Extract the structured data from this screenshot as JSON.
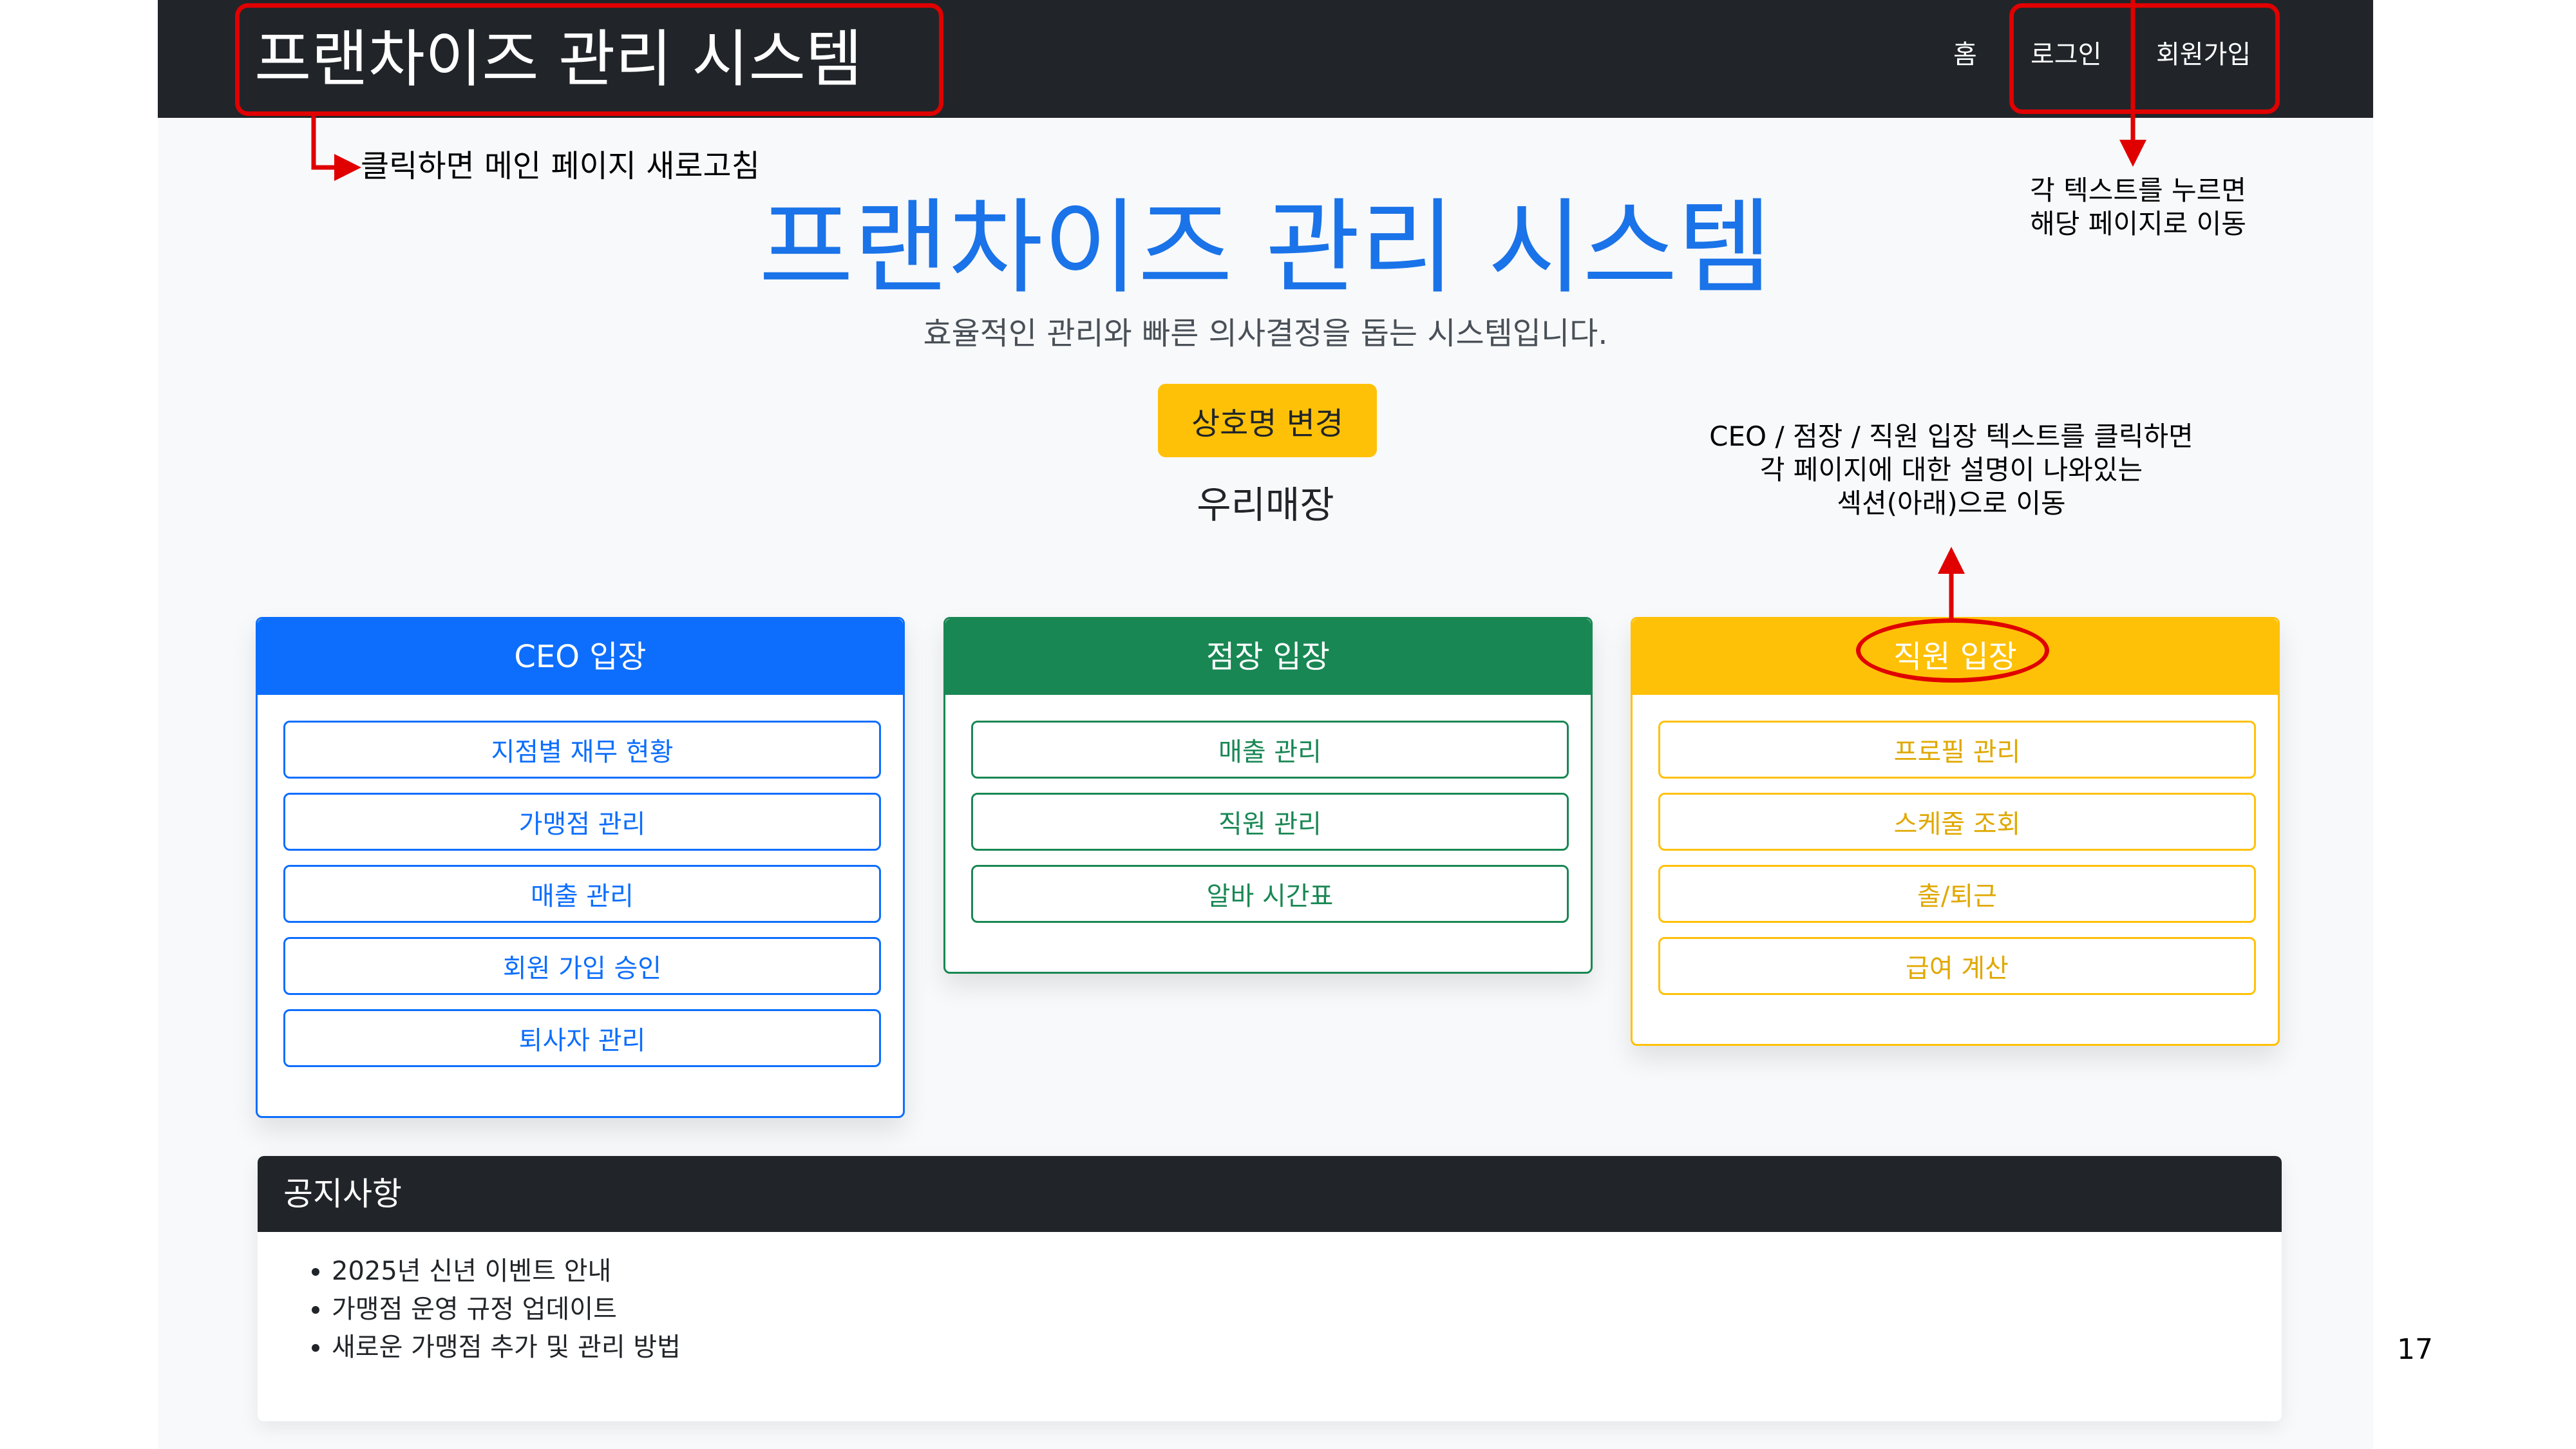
{
  "navbar": {
    "brand": "프랜차이즈 관리 시스템",
    "links": [
      "홈",
      "로그인",
      "회원가입"
    ]
  },
  "hero": {
    "title": "프랜차이즈 관리 시스템",
    "subtitle": "효율적인 관리와 빠른 의사결정을 돕는 시스템입니다.",
    "change_name_button": "상호명 변경",
    "store_name": "우리매장"
  },
  "cards": [
    {
      "title": "CEO 입장",
      "color": "#0d6efd",
      "buttons": [
        "지점별 재무 현황",
        "가맹점 관리",
        "매출 관리",
        "회원 가입 승인",
        "퇴사자 관리"
      ]
    },
    {
      "title": "점장 입장",
      "color": "#198754",
      "buttons": [
        "매출 관리",
        "직원 관리",
        "알바 시간표"
      ]
    },
    {
      "title": "직원 입장",
      "color": "#ffc107",
      "buttons": [
        "프로필 관리",
        "스케줄 조회",
        "출/퇴근",
        "급여 계산"
      ]
    }
  ],
  "notice": {
    "title": "공지사항",
    "items": [
      "2025년 신년 이벤트 안내",
      "가맹점 운영 규정 업데이트",
      "새로운 가맹점 추가 및 관리 방법"
    ]
  },
  "annotations": {
    "brand_note": "클릭하면 메인 페이지 새로고침",
    "nav_note": [
      "각 텍스트를 누르면",
      "해당 페이지로 이동"
    ],
    "role_note": [
      "CEO / 점장 / 직원 입장 텍스트를 클릭하면",
      "각 페이지에 대한 설명이 나와있는",
      "섹션(아래)으로 이동"
    ],
    "accent_color": "#e00000"
  },
  "page_number": "17"
}
